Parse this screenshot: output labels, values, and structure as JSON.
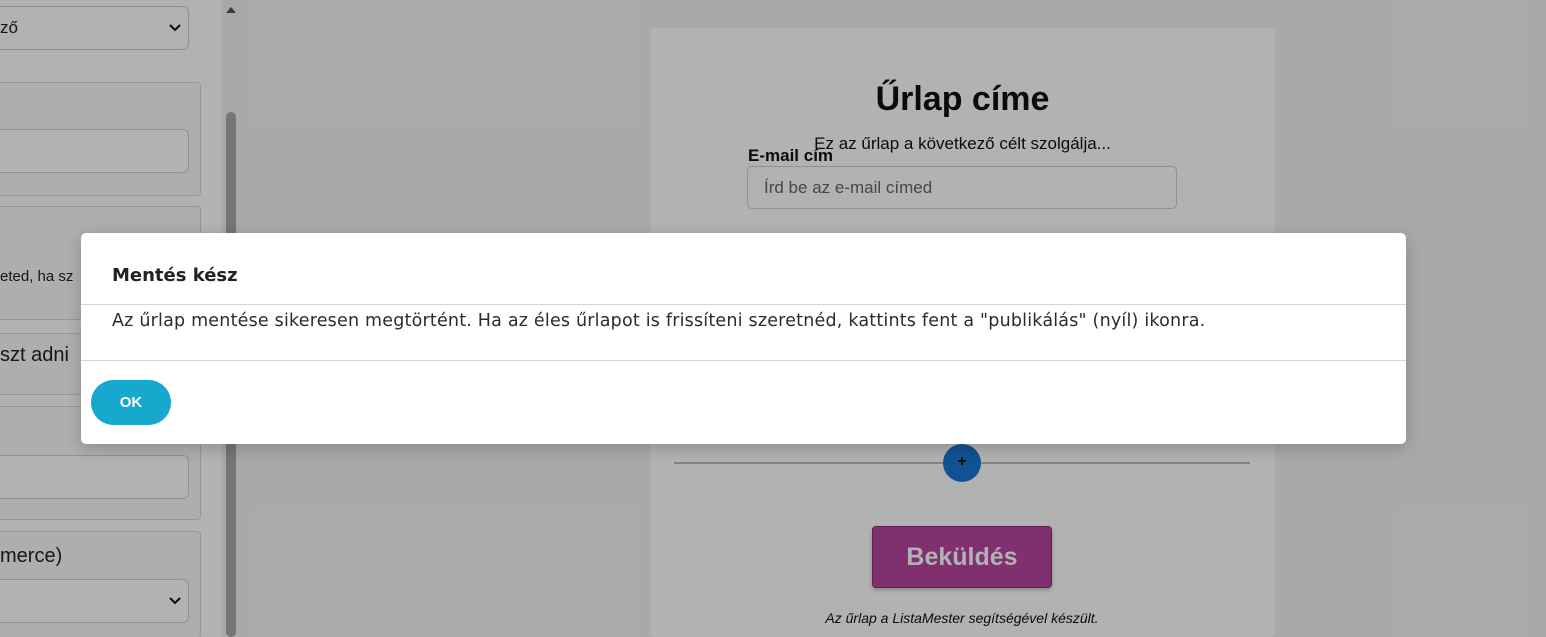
{
  "left_panel": {
    "select_1_value": "ző",
    "helper_text": "eted, ha sz",
    "label_add": "szt adni",
    "label_ecommerce": "merce)"
  },
  "form": {
    "title": "Űrlap címe",
    "subtitle": "Ez az űrlap a következő célt szolgálja...",
    "email_label": "E-mail cím",
    "email_placeholder": "Írd be az e-mail címed",
    "add_button": "+",
    "submit_label": "Beküldés",
    "footer": "Az űrlap a ListaMester segítségével készült."
  },
  "modal": {
    "title": "Mentés kész",
    "message": "Az űrlap mentése sikeresen megtörtént. Ha az éles űrlapot is frissíteni szeretnéd, kattints fent a \"publikálás\" (nyíl) ikonra.",
    "ok_label": "OK"
  },
  "colors": {
    "ok_button": "#17a9cd",
    "submit_button": "#b8459f",
    "add_button": "#1976d2"
  }
}
